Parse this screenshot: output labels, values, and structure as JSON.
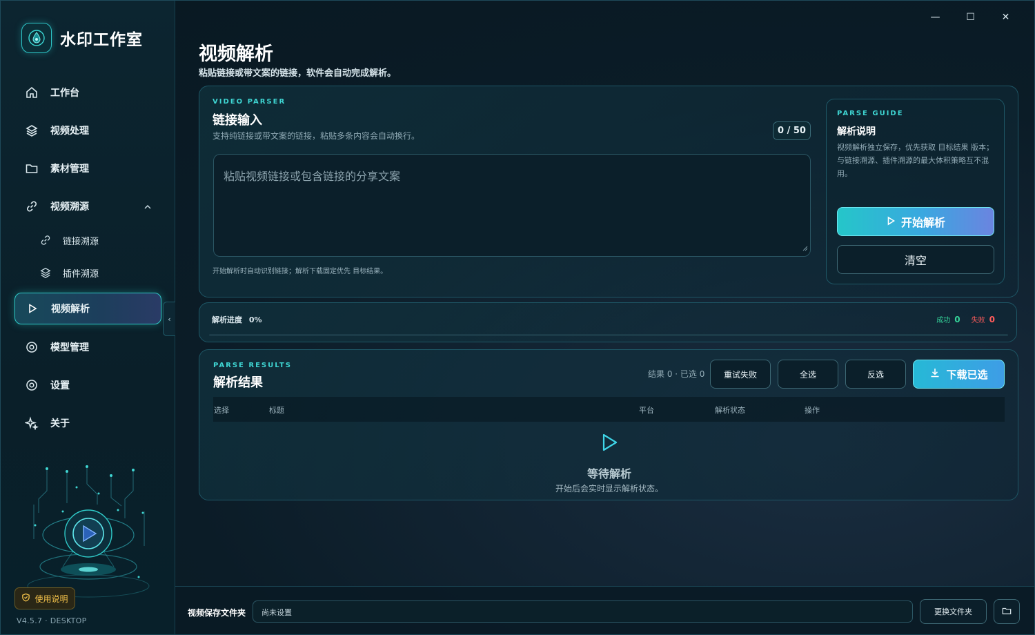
{
  "app": {
    "name": "水印工作室",
    "version": "V4.5.7 · DESKTOP",
    "help_label": "使用说明"
  },
  "window": {
    "minimize": "—",
    "maximize": "☐",
    "close": "✕"
  },
  "nav": {
    "workbench": "工作台",
    "video_processing": "视频处理",
    "material_management": "素材管理",
    "video_trace": "视频溯源",
    "link_trace": "链接溯源",
    "plugin_trace": "插件溯源",
    "video_parse": "视频解析",
    "model_management": "模型管理",
    "settings": "设置",
    "about": "关于",
    "collapse": "‹"
  },
  "header": {
    "title": "视频解析",
    "subtitle": "粘贴链接或带文案的链接，软件会自动完成解析。"
  },
  "input_card": {
    "eyebrow": "VIDEO PARSER",
    "title": "链接输入",
    "description": "支持纯链接或带文案的链接，粘贴多条内容会自动换行。",
    "counter": "0 / 50",
    "placeholder": "粘贴视频链接或包含链接的分享文案",
    "hint": "开始解析时自动识别链接；解析下载固定优先 目标结果。"
  },
  "guide": {
    "eyebrow": "PARSE GUIDE",
    "title": "解析说明",
    "body": "视频解析独立保存，优先获取 目标结果 版本；与链接溯源、插件溯源的最大体积策略互不混用。",
    "start_label": "开始解析",
    "clear_label": "清空"
  },
  "progress": {
    "label": "解析进度",
    "percent_text": "0%",
    "percent": 0,
    "success_label": "成功",
    "success_count": "0",
    "fail_label": "失败",
    "fail_count": "0"
  },
  "results": {
    "eyebrow": "PARSE RESULTS",
    "title": "解析结果",
    "count_text": "结果 0 · 已选 0",
    "retry_label": "重试失败",
    "select_all_label": "全选",
    "invert_label": "反选",
    "download_label": "下载已选",
    "columns": [
      "选择",
      "标题",
      "平台",
      "解析状态",
      "操作"
    ],
    "empty_title": "等待解析",
    "empty_subtitle": "开始后会实时显示解析状态。"
  },
  "footer": {
    "label": "视频保存文件夹",
    "path": "尚未设置",
    "change_label": "更换文件夹"
  },
  "colors": {
    "accent": "#2fc9c7",
    "success": "#35d49a",
    "danger": "#ff5b5b",
    "warning": "#f3c24a"
  }
}
